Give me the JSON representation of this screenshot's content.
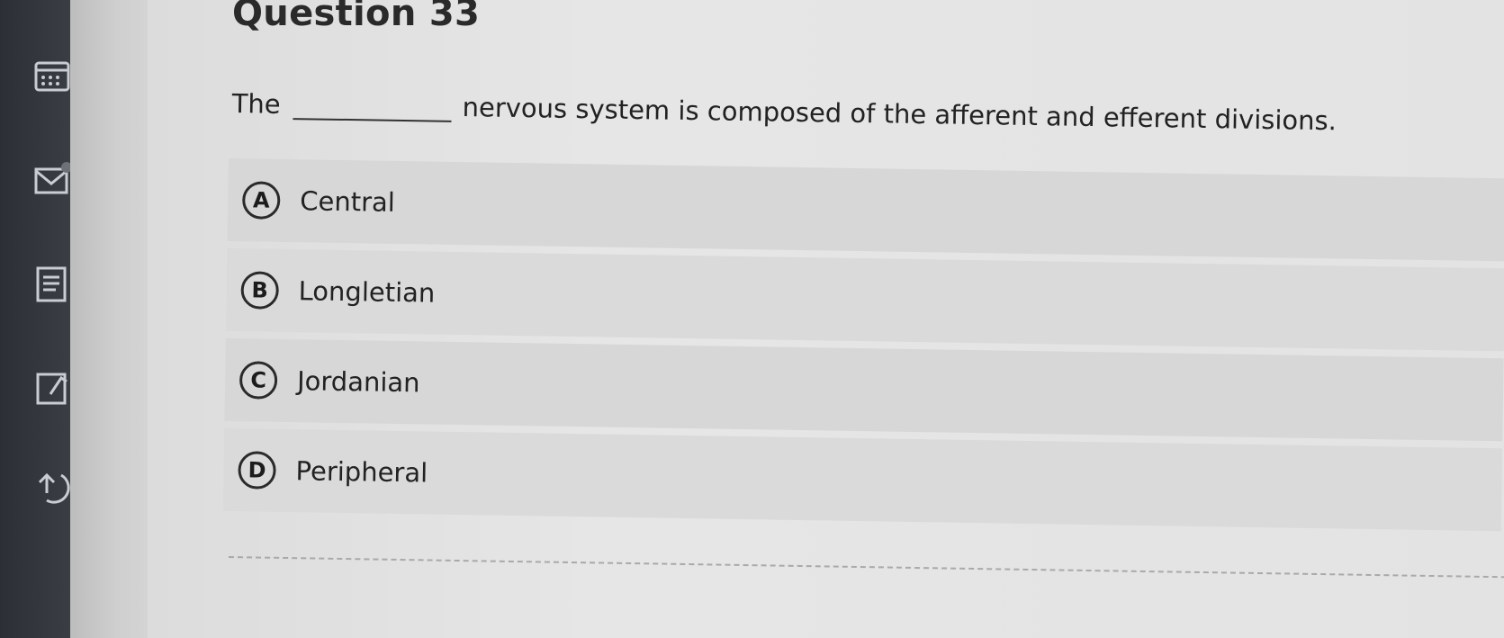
{
  "question": {
    "title": "Question 33",
    "prompt_before": "The",
    "prompt_after": "nervous system is composed of the afferent and efferent divisions."
  },
  "options": [
    {
      "letter": "A",
      "text": "Central"
    },
    {
      "letter": "B",
      "text": "Longletian"
    },
    {
      "letter": "C",
      "text": "Jordanian"
    },
    {
      "letter": "D",
      "text": "Peripheral"
    }
  ],
  "toolbar": {
    "icons": [
      "calculator-icon",
      "mail-icon",
      "notes-icon",
      "flag-icon",
      "back-icon"
    ]
  }
}
